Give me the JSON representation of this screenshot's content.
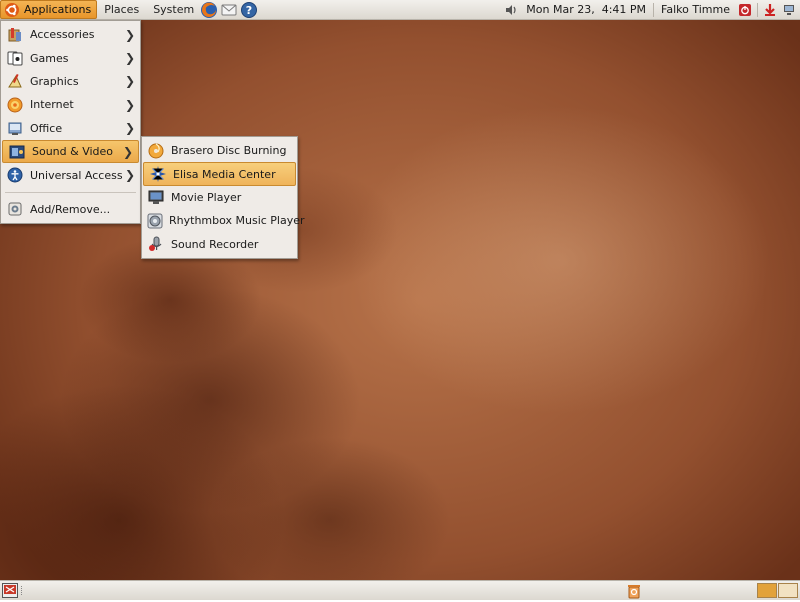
{
  "top_panel": {
    "menus": [
      "Applications",
      "Places",
      "System"
    ],
    "launchers": [
      "firefox-icon",
      "mail-icon",
      "help-icon"
    ],
    "clock": "Mon Mar 23,  4:41 PM",
    "user": "Falko Timme"
  },
  "applications_menu": {
    "items": [
      {
        "label": "Accessories",
        "icon": "accessories-icon",
        "has_submenu": true
      },
      {
        "label": "Games",
        "icon": "games-icon",
        "has_submenu": true
      },
      {
        "label": "Graphics",
        "icon": "graphics-icon",
        "has_submenu": true
      },
      {
        "label": "Internet",
        "icon": "internet-icon",
        "has_submenu": true
      },
      {
        "label": "Office",
        "icon": "office-icon",
        "has_submenu": true
      },
      {
        "label": "Sound & Video",
        "icon": "sound-video-icon",
        "has_submenu": true
      },
      {
        "label": "Universal Access",
        "icon": "universal-access-icon",
        "has_submenu": true
      }
    ],
    "footer_item": {
      "label": "Add/Remove...",
      "icon": "add-remove-icon"
    }
  },
  "sound_video_submenu": {
    "items": [
      {
        "label": "Brasero Disc Burning",
        "icon": "brasero-icon"
      },
      {
        "label": "Elisa Media Center",
        "icon": "elisa-icon"
      },
      {
        "label": "Movie Player",
        "icon": "movie-player-icon"
      },
      {
        "label": "Rhythmbox Music Player",
        "icon": "rhythmbox-icon"
      },
      {
        "label": "Sound Recorder",
        "icon": "sound-recorder-icon"
      }
    ]
  },
  "colors": {
    "highlight": "#eba94a",
    "panel": "#e6e2dc",
    "wallpaper": "#9a5633"
  }
}
